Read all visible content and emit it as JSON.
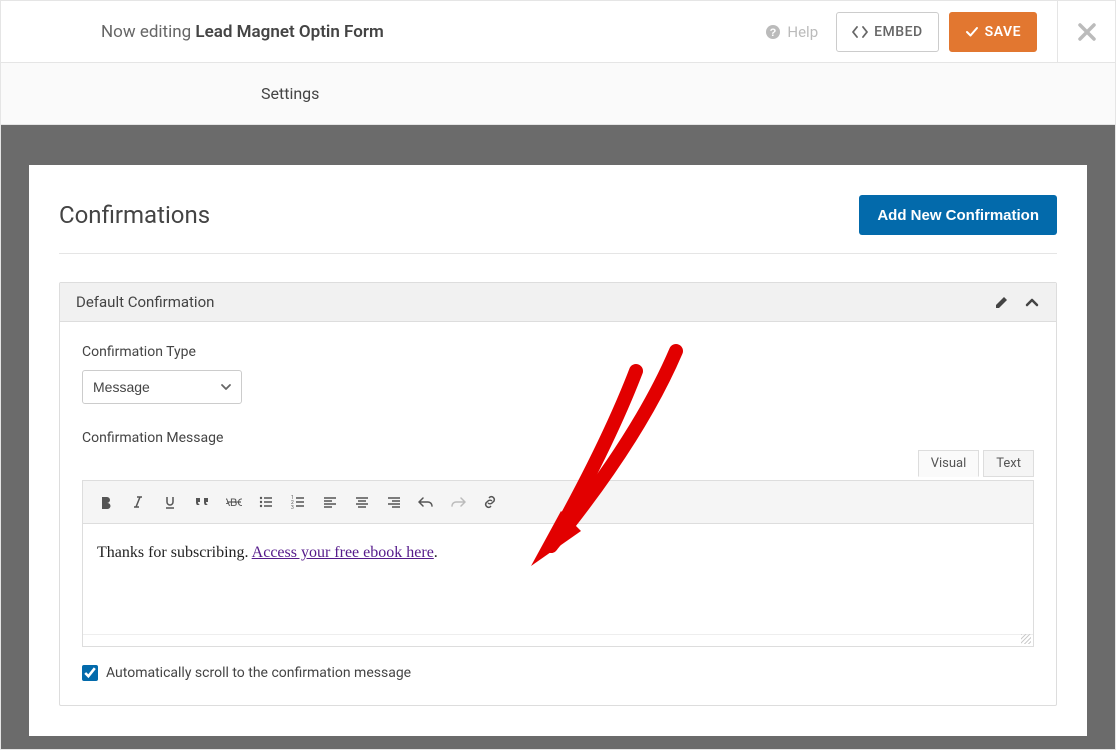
{
  "header": {
    "editing_prefix": "Now editing ",
    "form_name": "Lead Magnet Optin Form",
    "help_label": "Help",
    "embed_label": "EMBED",
    "save_label": "SAVE"
  },
  "subnav": {
    "settings_label": "Settings"
  },
  "panel": {
    "title": "Confirmations",
    "add_button": "Add New Confirmation"
  },
  "confirmation": {
    "header_title": "Default Confirmation",
    "type_label": "Confirmation Type",
    "type_value": "Message",
    "message_label": "Confirmation Message",
    "tabs": {
      "visual": "Visual",
      "text": "Text"
    },
    "message_prefix": "Thanks for subscribing. ",
    "message_link_text": "Access your free ebook here",
    "message_suffix": ".",
    "scroll_checkbox_label": "Automatically scroll to the confirmation message",
    "scroll_checked": true
  },
  "toolbar_icons": [
    "bold",
    "italic",
    "underline",
    "quote",
    "strike",
    "ul",
    "ol",
    "align-left",
    "align-center",
    "align-right",
    "undo",
    "redo",
    "link"
  ]
}
